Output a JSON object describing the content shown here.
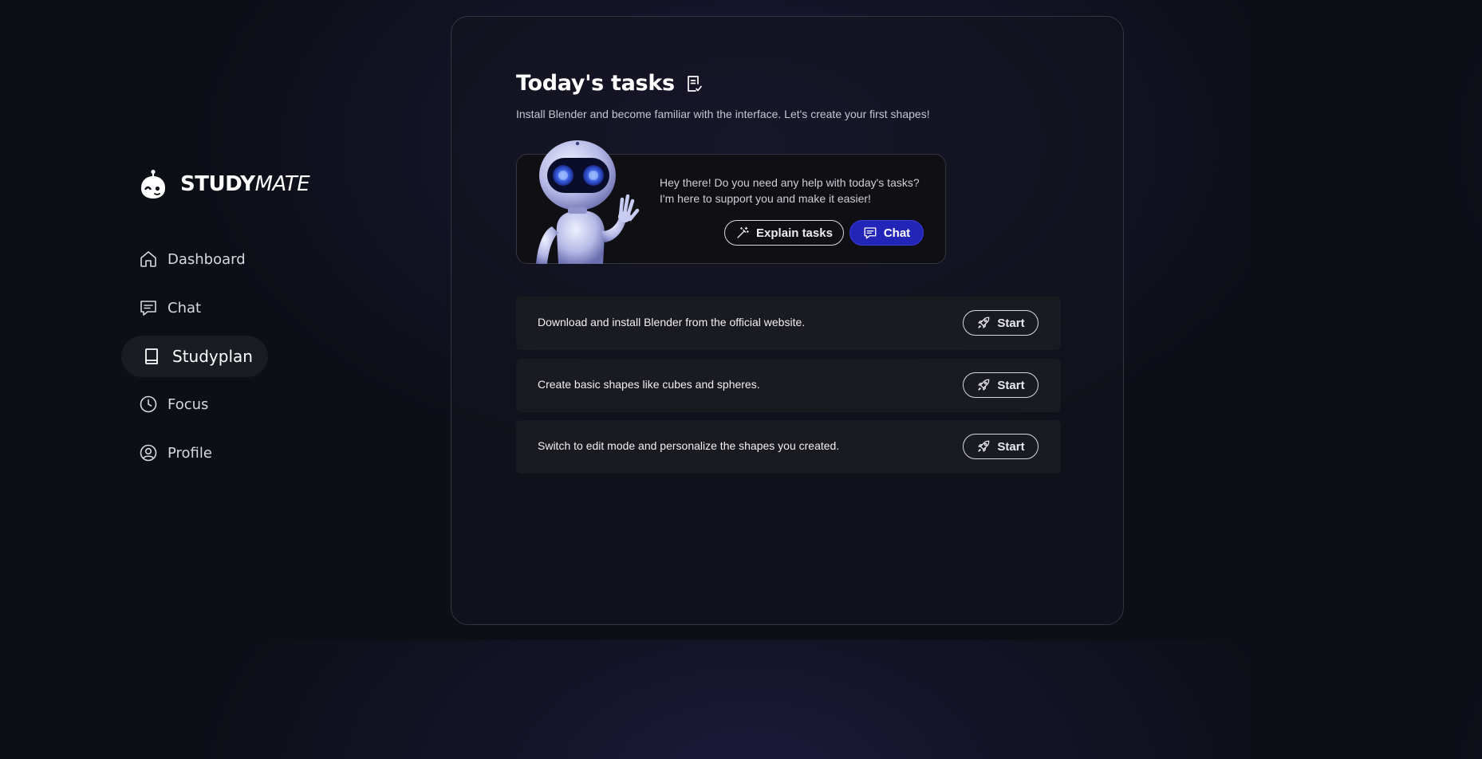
{
  "brand": {
    "name_part1": "STUDY",
    "name_part2": "MATE",
    "icon": "robot-logo-icon"
  },
  "sidebar": {
    "items": [
      {
        "label": "Dashboard",
        "icon": "home-icon",
        "active": false
      },
      {
        "label": "Chat",
        "icon": "chat-icon",
        "active": false
      },
      {
        "label": "Studyplan",
        "icon": "book-icon",
        "active": true
      },
      {
        "label": "Focus",
        "icon": "clock-icon",
        "active": false
      },
      {
        "label": "Profile",
        "icon": "user-circle-icon",
        "active": false
      }
    ]
  },
  "main": {
    "title": "Today's tasks",
    "title_icon": "task-list-check-icon",
    "subtitle": "Install Blender and become familiar with the interface. Let's create your first shapes!",
    "assistant": {
      "line1": "Hey there! Do you need any help with today's tasks?",
      "line2": "I'm here to support you and make it easier!",
      "explain_label": "Explain tasks",
      "chat_label": "Chat"
    },
    "tasks": [
      {
        "text": "Download and install Blender from the official website.",
        "button": "Start"
      },
      {
        "text": "Create basic shapes like cubes and spheres.",
        "button": "Start"
      },
      {
        "text": "Switch to edit mode and personalize the shapes you created.",
        "button": "Start"
      }
    ]
  },
  "colors": {
    "background": "#0d0f17",
    "accent": "#2325b8",
    "panel_border": "#34363f",
    "task_row": "#1a1b20"
  }
}
